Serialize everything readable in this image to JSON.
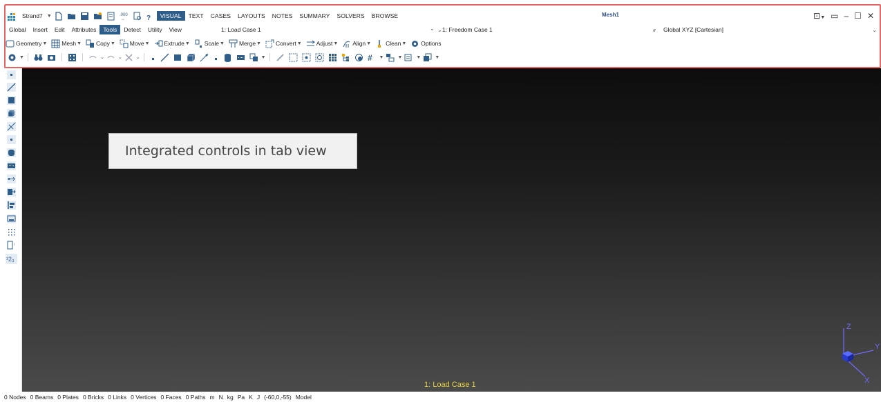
{
  "header": {
    "app_menu": "Strand7",
    "tabs": [
      "VISUAL",
      "TEXT",
      "CASES",
      "LAYOUTS",
      "NOTES",
      "SUMMARY",
      "SOLVERS",
      "BROWSE"
    ],
    "active_tab": "VISUAL",
    "window_title": "Mesh1"
  },
  "menu": {
    "items": [
      "Global",
      "Insert",
      "Edit",
      "Attributes",
      "Tools",
      "Detect",
      "Utility",
      "View"
    ],
    "active": "Tools",
    "load_case": "1: Load Case 1",
    "freedom_case": "1: Freedom Case 1",
    "coord_system": "Global XYZ [Cartesian]"
  },
  "tools": {
    "items": [
      "Geometry",
      "Mesh",
      "Copy",
      "Move",
      "Extrude",
      "Scale",
      "Merge",
      "Convert",
      "Adjust",
      "Align",
      "Clean",
      "Options"
    ]
  },
  "viewport": {
    "callout": "Integrated controls in tab view",
    "case_label": "1: Load Case 1",
    "axes": {
      "z": "Z",
      "y": "Y",
      "x": "X"
    }
  },
  "status": {
    "items": [
      "0 Nodes",
      "0 Beams",
      "0 Plates",
      "0 Bricks",
      "0 Links",
      "0 Vertices",
      "0 Faces",
      "0 Paths",
      "m",
      "N",
      "kg",
      "Pa",
      "K",
      "J",
      "(-60,0,-55)",
      "Model"
    ]
  },
  "colors": {
    "accent": "#2f5d8a",
    "highlight_outline": "#e8625f",
    "case_label": "#e8d43a",
    "axis": "#6f6cff"
  }
}
